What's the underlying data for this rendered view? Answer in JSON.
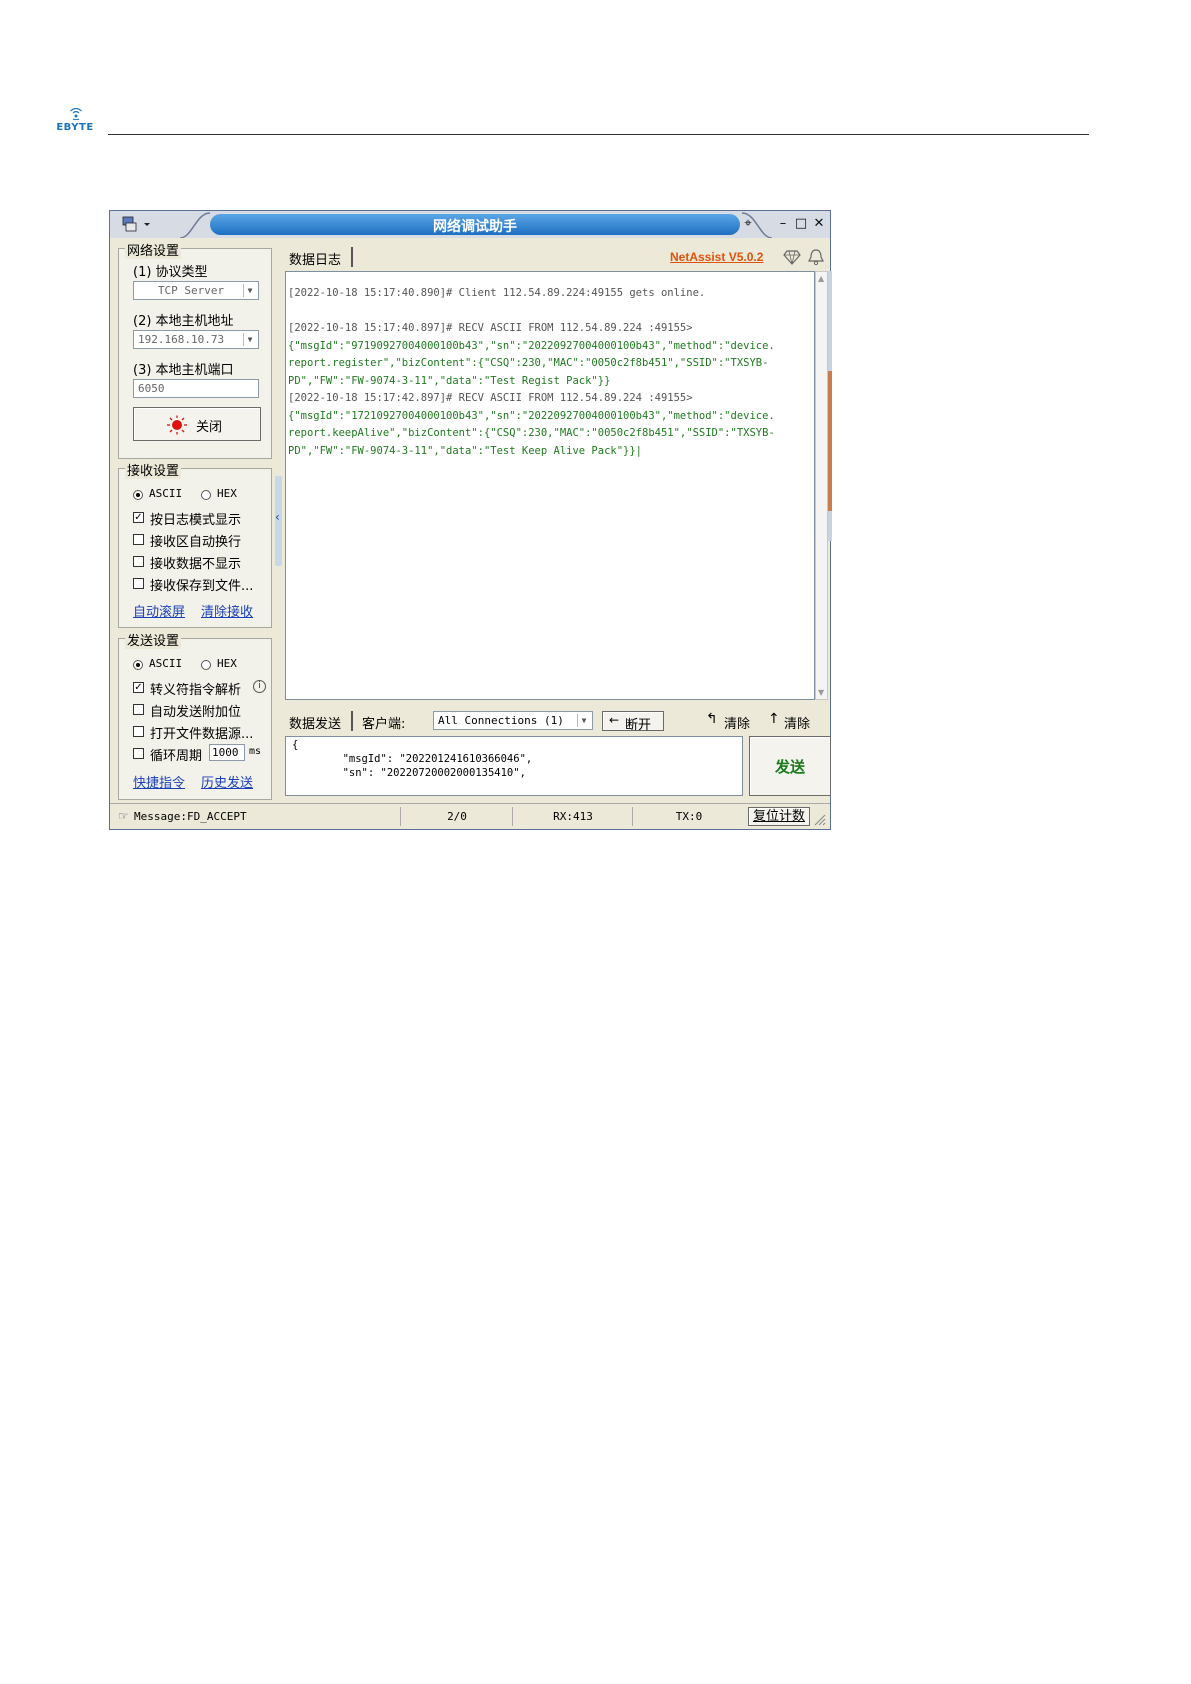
{
  "doc": {
    "brand": "EBYTE"
  },
  "window": {
    "title": "网络调试助手",
    "app_version": "NetAssist V5.0.2"
  },
  "network": {
    "group_label": "网络设置",
    "protocol_label": "(1) 协议类型",
    "protocol_value": "TCP Server",
    "host_label": "(2) 本地主机地址",
    "host_value": "192.168.10.73",
    "port_label": "(3) 本地主机端口",
    "port_value": "6050",
    "close_button": "关闭"
  },
  "receive": {
    "group_label": "接收设置",
    "ascii": "ASCII",
    "hex": "HEX",
    "options": [
      {
        "label": "按日志模式显示",
        "checked": true
      },
      {
        "label": "接收区自动换行",
        "checked": false
      },
      {
        "label": "接收数据不显示",
        "checked": false
      },
      {
        "label": "接收保存到文件...",
        "checked": false
      }
    ],
    "link_autoscroll": "自动滚屏",
    "link_clear": "清除接收"
  },
  "send": {
    "group_label": "发送设置",
    "ascii": "ASCII",
    "hex": "HEX",
    "options": [
      {
        "label": "转义符指令解析",
        "checked": true
      },
      {
        "label": "自动发送附加位",
        "checked": false
      },
      {
        "label": "打开文件数据源...",
        "checked": false
      },
      {
        "label": "循环周期",
        "checked": false
      }
    ],
    "cycle_value": "1000",
    "cycle_unit": "ms",
    "link_shortcut": "快捷指令",
    "link_history": "历史发送"
  },
  "log": {
    "tab": "数据日志",
    "lines": [
      {
        "text": "[2022-10-18 15:17:40.890]# Client 112.54.89.224:49155 gets online.",
        "kind": "gray"
      },
      {
        "text": "",
        "kind": "gray"
      },
      {
        "text": "[2022-10-18 15:17:40.897]# RECV ASCII FROM 112.54.89.224 :49155>",
        "kind": "gray"
      },
      {
        "text": "{\"msgId\":\"97190927004000100b43\",\"sn\":\"20220927004000100b43\",\"method\":\"device.",
        "kind": "green"
      },
      {
        "text": "report.register\",\"bizContent\":{\"CSQ\":230,\"MAC\":\"0050c2f8b451\",\"SSID\":\"TXSYB-",
        "kind": "green"
      },
      {
        "text": "PD\",\"FW\":\"FW-9074-3-11\",\"data\":\"Test Regist Pack\"}}",
        "kind": "green"
      },
      {
        "text": "[2022-10-18 15:17:42.897]# RECV ASCII FROM 112.54.89.224 :49155>",
        "kind": "gray"
      },
      {
        "text": "{\"msgId\":\"17210927004000100b43\",\"sn\":\"20220927004000100b43\",\"method\":\"device.",
        "kind": "green"
      },
      {
        "text": "report.keepAlive\",\"bizContent\":{\"CSQ\":230,\"MAC\":\"0050c2f8b451\",\"SSID\":\"TXSYB-",
        "kind": "green"
      },
      {
        "text": "PD\",\"FW\":\"FW-9074-3-11\",\"data\":\"Test Keep Alive Pack\"}}|",
        "kind": "green"
      }
    ]
  },
  "send_area": {
    "tab": "数据发送",
    "client_label": "客户端:",
    "client_value": "All Connections (1)",
    "disconnect": "断开",
    "clear1": "清除",
    "clear2": "清除",
    "text_lines": [
      "{",
      "        \"msgId\": \"202201241610366046\",",
      "        \"sn\": \"20220720002000135410\","
    ],
    "send_button": "发送"
  },
  "status": {
    "message": "Message:FD_ACCEPT",
    "count": "2/0",
    "rx": "RX:413",
    "tx": "TX:0",
    "reset": "复位计数"
  }
}
